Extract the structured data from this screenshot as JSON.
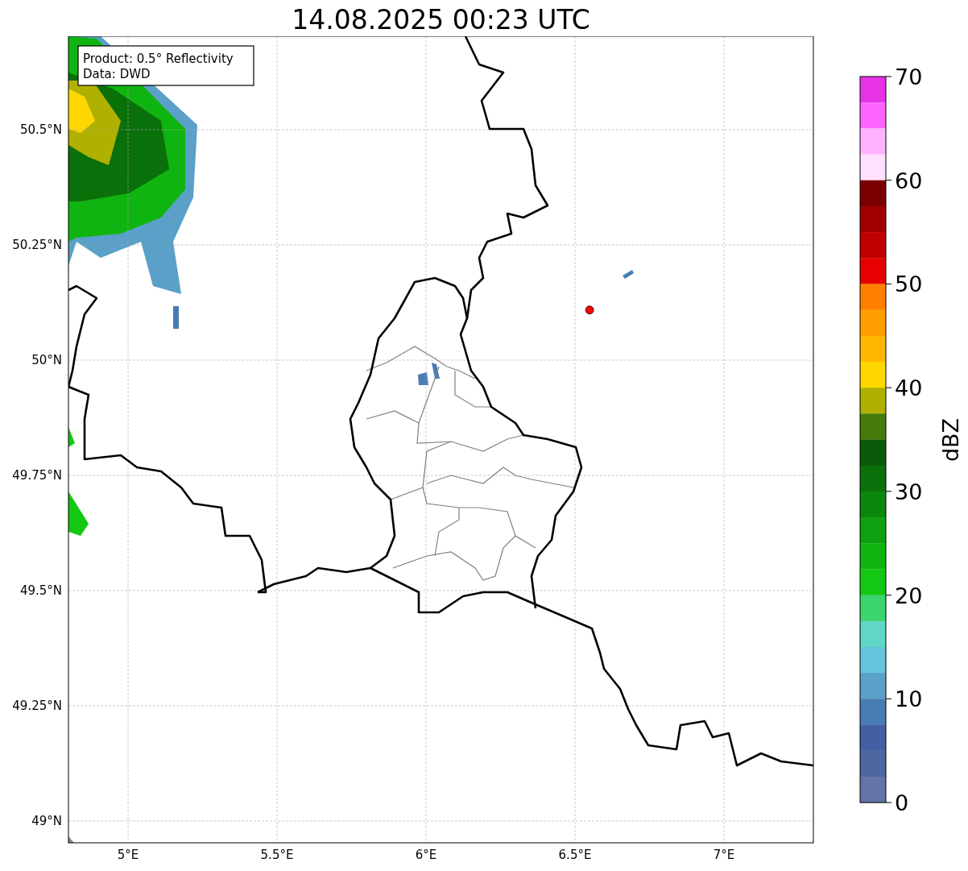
{
  "title": "14.08.2025 00:23 UTC",
  "annotation": [
    "Product: 0.5° Reflectivity",
    "Data: DWD"
  ],
  "map": {
    "lon_ticks": [
      "5°E",
      "5.5°E",
      "6°E",
      "6.5°E",
      "7°E"
    ],
    "lat_ticks": [
      "50.5°N",
      "50.25°N",
      "50°N",
      "49.75°N",
      "49.5°N",
      "49.25°N",
      "49°N"
    ],
    "station": {
      "color": "#ff0000"
    }
  },
  "colorbar": {
    "label": "dBZ",
    "ticks": [
      "70",
      "60",
      "50",
      "40",
      "30",
      "20",
      "10",
      "0"
    ],
    "segments": [
      {
        "color": "#e633e6"
      },
      {
        "color": "#ff66ff"
      },
      {
        "color": "#ffb3ff"
      },
      {
        "color": "#ffe0ff"
      },
      {
        "color": "#7a0000"
      },
      {
        "color": "#a00000"
      },
      {
        "color": "#c00000"
      },
      {
        "color": "#e60000"
      },
      {
        "color": "#ff8000"
      },
      {
        "color": "#ff9e00"
      },
      {
        "color": "#ffb700"
      },
      {
        "color": "#ffd700"
      },
      {
        "color": "#b0b000"
      },
      {
        "color": "#467a0a"
      },
      {
        "color": "#0a5a0a"
      },
      {
        "color": "#0a700a"
      },
      {
        "color": "#0b880b"
      },
      {
        "color": "#0ea00e"
      },
      {
        "color": "#10b410"
      },
      {
        "color": "#12c812"
      },
      {
        "color": "#3cd46c"
      },
      {
        "color": "#60d6c4"
      },
      {
        "color": "#64c4dc"
      },
      {
        "color": "#5aa0c8"
      },
      {
        "color": "#4a7cb4"
      },
      {
        "color": "#4460a4"
      },
      {
        "color": "#5066a0"
      },
      {
        "color": "#6474a8"
      }
    ]
  }
}
